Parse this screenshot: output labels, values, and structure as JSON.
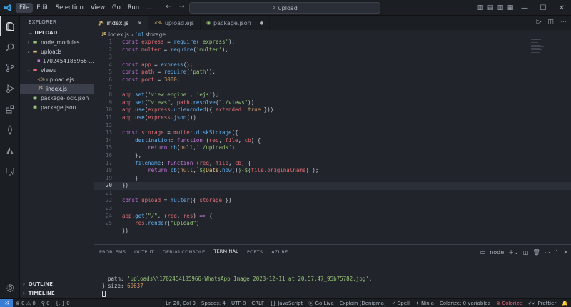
{
  "titlebar": {
    "menu": [
      "File",
      "Edit",
      "Selection",
      "View",
      "Go",
      "Run",
      "…"
    ],
    "search": "upload"
  },
  "sidebar": {
    "title": "EXPLORER",
    "root": "UPLOAD",
    "items": [
      {
        "label": "node_modules",
        "type": "folder",
        "open": false,
        "indent": 1
      },
      {
        "label": "uploads",
        "type": "folder",
        "open": true,
        "indent": 1
      },
      {
        "label": "1702454185966-...",
        "type": "file",
        "indent": 2
      },
      {
        "label": "views",
        "type": "folder",
        "open": true,
        "indent": 1
      },
      {
        "label": "upload.ejs",
        "type": "ejs",
        "indent": 2
      },
      {
        "label": "index.js",
        "type": "js",
        "indent": 2,
        "selected": true
      },
      {
        "label": "package-lock.json",
        "type": "json",
        "indent": 1
      },
      {
        "label": "package.json",
        "type": "json",
        "indent": 1
      }
    ],
    "outline": "OUTLINE",
    "timeline": "TIMELINE"
  },
  "tabs": [
    {
      "label": "index.js",
      "icon": "JS",
      "active": true
    },
    {
      "label": "upload.ejs",
      "icon": "<%",
      "active": false
    },
    {
      "label": "package.json",
      "icon": "{}",
      "active": false,
      "dirty": true
    }
  ],
  "breadcrumb": {
    "file": "index.js",
    "symbol": "storage"
  },
  "code": {
    "current_line": 20,
    "lines": [
      "1",
      "2",
      "3",
      "4",
      "5",
      "6",
      "7",
      "8",
      "9",
      "10",
      "11",
      "12",
      "13",
      "14",
      "15",
      "16",
      "17",
      "18",
      "19",
      "20",
      "21",
      "22",
      "23",
      "24",
      "25"
    ]
  },
  "panel": {
    "tabs": [
      "PROBLEMS",
      "OUTPUT",
      "DEBUG CONSOLE",
      "TERMINAL",
      "PORTS",
      "AZURE"
    ],
    "active_tab": "TERMINAL",
    "terminal_name": "node",
    "terminal": {
      "path_key": "path: ",
      "path_val": "'uploads\\\\1702454185966-WhatsApp Image 2023-12-11 at 20.57.47_95b75782.jpg'",
      "size_key": "size: ",
      "size_val": "60637",
      "close": "}"
    }
  },
  "statusbar": {
    "errors": "0",
    "warnings": "0",
    "ports": "0",
    "linenum": "{..} 0",
    "position": "Ln 20, Col 3",
    "spaces": "Spaces: 4",
    "encoding": "UTF-8",
    "eol": "CRLF",
    "language": "JavaScript",
    "golive": "Go Live",
    "explain": "Explain (Denigma)",
    "spell": "Spell",
    "ninja": "Ninja",
    "colorize_vars": "Colorize: 0 variables",
    "colorize": "Colorize",
    "prettier": "Prettier"
  }
}
